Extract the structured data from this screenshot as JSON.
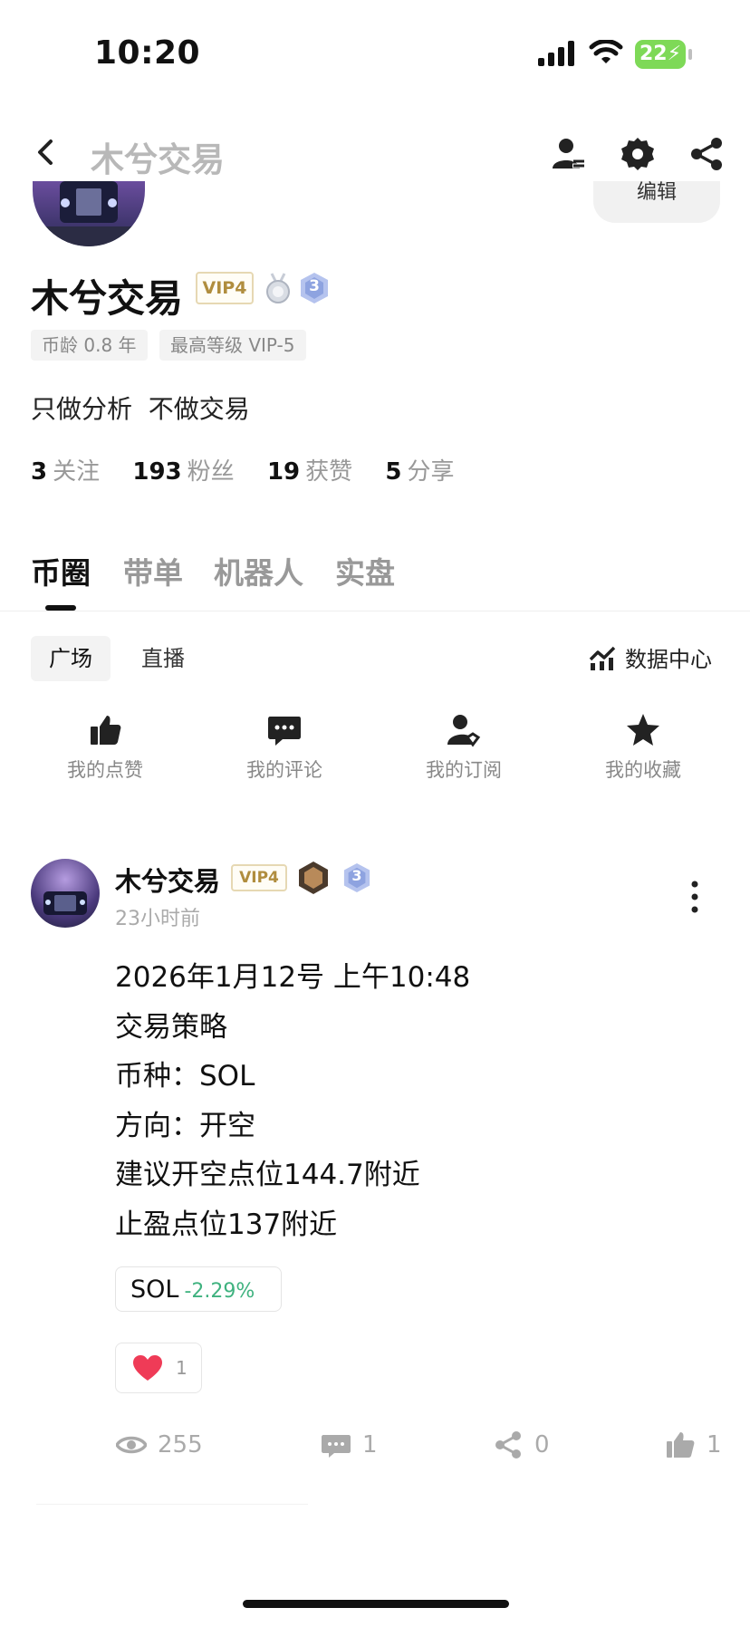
{
  "status_bar": {
    "time": "10:20",
    "battery": "22"
  },
  "nav": {
    "title": "木兮交易"
  },
  "profile": {
    "edit_label": "编辑",
    "name": "木兮交易",
    "vip": "VIP4",
    "level": "3",
    "tags": [
      "币龄 0.8 年",
      "最高等级 VIP-5"
    ],
    "bio": "只做分析  不做交易",
    "stats": [
      {
        "value": "3",
        "label": "关注"
      },
      {
        "value": "193",
        "label": "粉丝"
      },
      {
        "value": "19",
        "label": "获赞"
      },
      {
        "value": "5",
        "label": "分享"
      }
    ]
  },
  "tabs": [
    "币圈",
    "带单",
    "机器人",
    "实盘"
  ],
  "subtabs": [
    "广场",
    "直播"
  ],
  "data_center": "数据中心",
  "shortcuts": [
    "我的点赞",
    "我的评论",
    "我的订阅",
    "我的收藏"
  ],
  "post": {
    "author": "木兮交易",
    "vip": "VIP4",
    "level": "3",
    "time": "23小时前",
    "lines": [
      "2026年1月12号 上午10:48",
      "交易策略",
      "币种：SOL",
      "方向：开空",
      "建议开空点位144.7附近",
      "止盈点位137附近"
    ],
    "coin": {
      "symbol": "SOL",
      "change": "-2.29%"
    },
    "reactions": "1",
    "views": "255",
    "comments": "1",
    "shares": "0",
    "likes": "1"
  },
  "colors": {
    "accent_green": "#3fb27f",
    "vip_gold": "#b08d3e",
    "heart_red": "#ef3b57"
  }
}
